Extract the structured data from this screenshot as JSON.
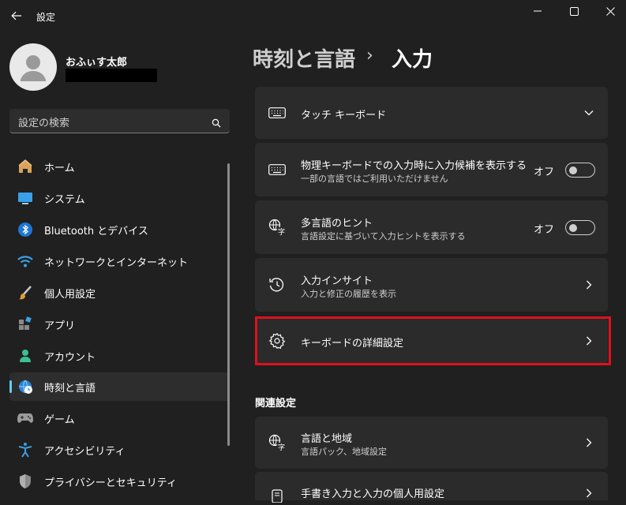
{
  "window": {
    "title": "設定",
    "controls": [
      "minimize",
      "maximize",
      "close"
    ]
  },
  "user": {
    "name": "おふぃす太郎"
  },
  "search": {
    "placeholder": "設定の検索"
  },
  "sidebar": {
    "items": [
      {
        "label": "ホーム",
        "icon": "home-icon"
      },
      {
        "label": "システム",
        "icon": "monitor-icon"
      },
      {
        "label": "Bluetooth とデバイス",
        "icon": "bluetooth-icon"
      },
      {
        "label": "ネットワークとインターネット",
        "icon": "wifi-icon"
      },
      {
        "label": "個人用設定",
        "icon": "brush-icon"
      },
      {
        "label": "アプリ",
        "icon": "apps-icon"
      },
      {
        "label": "アカウント",
        "icon": "person-icon"
      },
      {
        "label": "時刻と言語",
        "icon": "globe-clock-icon",
        "selected": true
      },
      {
        "label": "ゲーム",
        "icon": "gamepad-icon"
      },
      {
        "label": "アクセシビリティ",
        "icon": "accessibility-icon"
      },
      {
        "label": "プライバシーとセキュリティ",
        "icon": "shield-icon"
      }
    ]
  },
  "header": {
    "parent": "時刻と言語",
    "separator": "›",
    "current": "入力"
  },
  "settings": [
    {
      "title": "タッチ キーボード",
      "icon": "keyboard-icon",
      "control": "expand"
    },
    {
      "title": "物理キーボードでの入力時に入力候補を表示する",
      "subtitle": "一部の言語ではご利用いただけません",
      "icon": "keyboard-icon",
      "control": "toggle",
      "state_label": "オフ",
      "on": false
    },
    {
      "title": "多言語のヒント",
      "subtitle": "言語設定に基づいて入力ヒントを表示する",
      "icon": "language-icon",
      "control": "toggle",
      "state_label": "オフ",
      "on": false
    },
    {
      "title": "入力インサイト",
      "subtitle": "入力と修正の履歴を表示",
      "icon": "history-icon",
      "control": "navigate"
    },
    {
      "title": "キーボードの詳細設定",
      "icon": "gear-icon",
      "control": "navigate",
      "highlighted": true
    }
  ],
  "related": {
    "heading": "関連設定",
    "items": [
      {
        "title": "言語と地域",
        "subtitle": "言語パック、地域設定",
        "icon": "language-icon",
        "control": "navigate"
      },
      {
        "title": "手書き入力と入力の個人用設定",
        "icon": "pen-keyboard-icon",
        "control": "navigate"
      }
    ]
  },
  "colors": {
    "background": "#202020",
    "card": "#2b2b2b",
    "accent": "#60cdff",
    "highlight_border": "#e0101e"
  }
}
